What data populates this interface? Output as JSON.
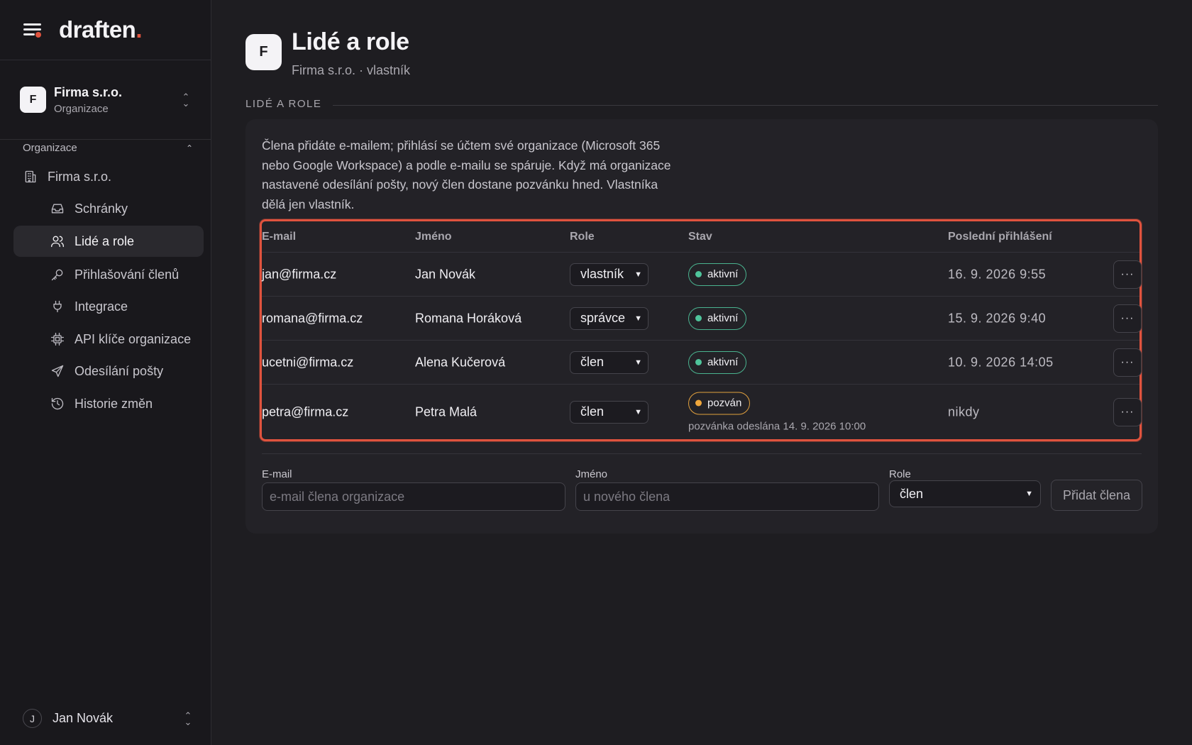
{
  "app": {
    "logo_text": "draften",
    "logo_dot": "."
  },
  "org_switcher": {
    "avatar": "F",
    "name": "Firma s.r.o.",
    "subtitle": "Organizace"
  },
  "sidebar": {
    "section_label": "Organizace",
    "items": [
      {
        "label": "Firma s.r.o.",
        "icon": "building-icon"
      },
      {
        "label": "Schránky",
        "icon": "inbox-icon"
      },
      {
        "label": "Lidé a role",
        "icon": "users-icon",
        "active": true
      },
      {
        "label": "Přihlašování členů",
        "icon": "key-icon"
      },
      {
        "label": "Integrace",
        "icon": "plug-icon"
      },
      {
        "label": "API klíče organizace",
        "icon": "chip-icon"
      },
      {
        "label": "Odesílání pošty",
        "icon": "send-icon"
      },
      {
        "label": "Historie změn",
        "icon": "history-icon"
      }
    ]
  },
  "user": {
    "avatar": "J",
    "name": "Jan Novák"
  },
  "header": {
    "avatar": "F",
    "title": "Lidé a role",
    "subtitle": "Firma s.r.o. · vlastník"
  },
  "section": {
    "label": "LIDÉ A ROLE"
  },
  "intro": "Člena přidáte e-mailem; přihlásí se účtem své organizace (Microsoft 365 nebo Google Workspace) a podle e-mailu se spáruje. Když má organizace nastavené odesílání pošty, nový člen dostane pozvánku hned. Vlastníka dělá jen vlastník.",
  "table": {
    "columns": [
      "E-mail",
      "Jméno",
      "Role",
      "Stav",
      "Poslední přihlášení"
    ],
    "rows": [
      {
        "email": "jan@firma.cz",
        "name": "Jan Novák",
        "role": "vlastník",
        "status": "aktivní",
        "status_kind": "active",
        "note": "",
        "last_login": "16. 9. 2026 9:55"
      },
      {
        "email": "romana@firma.cz",
        "name": "Romana Horáková",
        "role": "správce",
        "status": "aktivní",
        "status_kind": "active",
        "note": "",
        "last_login": "15. 9. 2026 9:40"
      },
      {
        "email": "ucetni@firma.cz",
        "name": "Alena Kučerová",
        "role": "člen",
        "status": "aktivní",
        "status_kind": "active",
        "note": "",
        "last_login": "10. 9. 2026 14:05"
      },
      {
        "email": "petra@firma.cz",
        "name": "Petra Malá",
        "role": "člen",
        "status": "pozván",
        "status_kind": "invited",
        "note": "pozvánka odeslána 14. 9. 2026 10:00",
        "last_login": "nikdy"
      }
    ],
    "more_label": "···"
  },
  "add_form": {
    "email_label": "E-mail",
    "email_placeholder": "e-mail člena organizace",
    "name_label": "Jméno",
    "name_placeholder": "u nového člena",
    "role_label": "Role",
    "role_value": "člen",
    "submit_label": "Přidat člena"
  },
  "colors": {
    "accent": "#e0533e",
    "active_status": "#4fc49b",
    "invited_status": "#f0a73c",
    "background": "#1e1d21",
    "sidebar": "#19181c"
  }
}
